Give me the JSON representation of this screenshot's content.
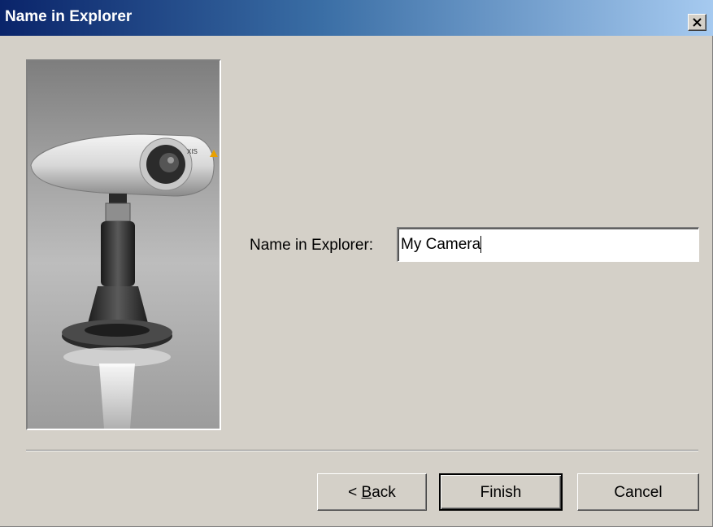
{
  "window": {
    "title": "Name in Explorer"
  },
  "image": {
    "alt": "network camera illustration"
  },
  "form": {
    "label": "Name in Explorer:",
    "value": "My Camera"
  },
  "buttons": {
    "back_prefix": "< ",
    "back_accel": "B",
    "back_rest": "ack",
    "finish": "Finish",
    "cancel": "Cancel"
  },
  "colors": {
    "titlebar_start": "#0a246a",
    "titlebar_end": "#a6caf0",
    "dialog_bg": "#d4d0c8"
  },
  "icons": {
    "close": "close-icon"
  }
}
